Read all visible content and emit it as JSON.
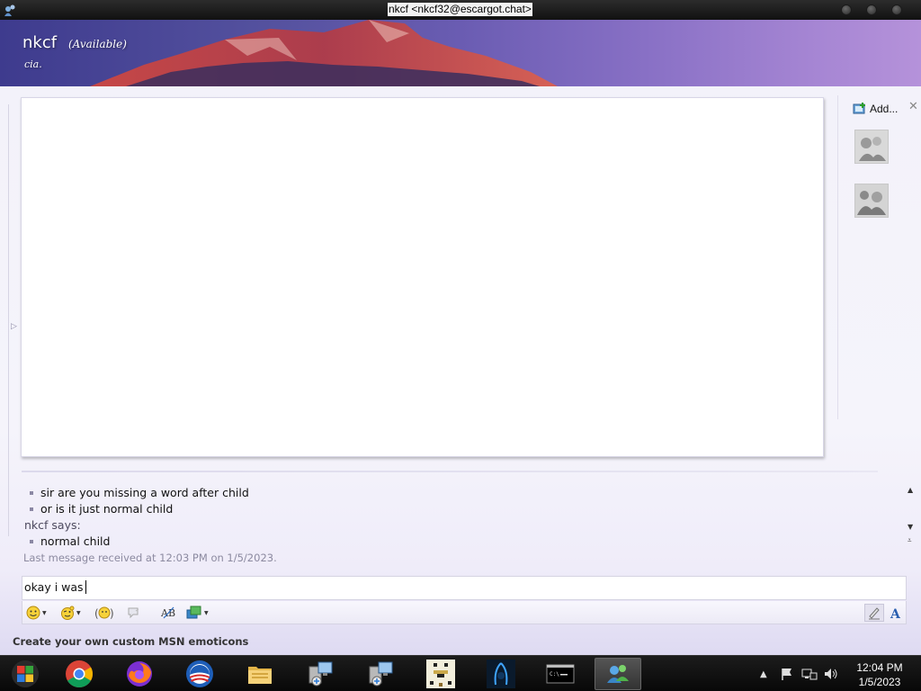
{
  "window": {
    "title": "nkcf <nkcf32@escargot.chat>"
  },
  "contact": {
    "name": "nkcf",
    "status": "(Available)",
    "personal_message": "cia."
  },
  "side_panel": {
    "add_label": "Add...",
    "close_glyph": "✕"
  },
  "conversation": {
    "lines": [
      {
        "type": "bullet",
        "text": "sir are you missing a word after child"
      },
      {
        "type": "bullet",
        "text": "or is it just normal child"
      },
      {
        "type": "says",
        "text": "nkcf says:"
      },
      {
        "type": "bullet",
        "text": "normal child"
      }
    ],
    "last_received": "Last message received at 12:03 PM on 1/5/2023."
  },
  "compose": {
    "text": "okay i was"
  },
  "toolbar": {
    "items": [
      {
        "name": "emoticon-icon",
        "dropdown": true
      },
      {
        "name": "wink-icon",
        "dropdown": true
      },
      {
        "name": "nudge-icon",
        "dropdown": false
      },
      {
        "name": "voice-clip-icon",
        "dropdown": false
      },
      {
        "name": "spell-check-icon",
        "dropdown": false
      },
      {
        "name": "background-icon",
        "dropdown": true
      }
    ],
    "right": [
      "handwriting-icon",
      "font-icon"
    ]
  },
  "promo": {
    "text": "Create your own custom MSN emoticons"
  },
  "taskbar": {
    "apps": [
      "start-orb-icon",
      "chrome-icon",
      "firefox-icon",
      "obama-logo-icon",
      "file-explorer-icon",
      "network-setup-icon",
      "network-setup-2-icon",
      "pixel-game-icon",
      "fortnite-icon",
      "command-prompt-icon",
      "messenger-icon"
    ],
    "clock_time": "12:04 PM",
    "clock_date": "1/5/2023"
  }
}
